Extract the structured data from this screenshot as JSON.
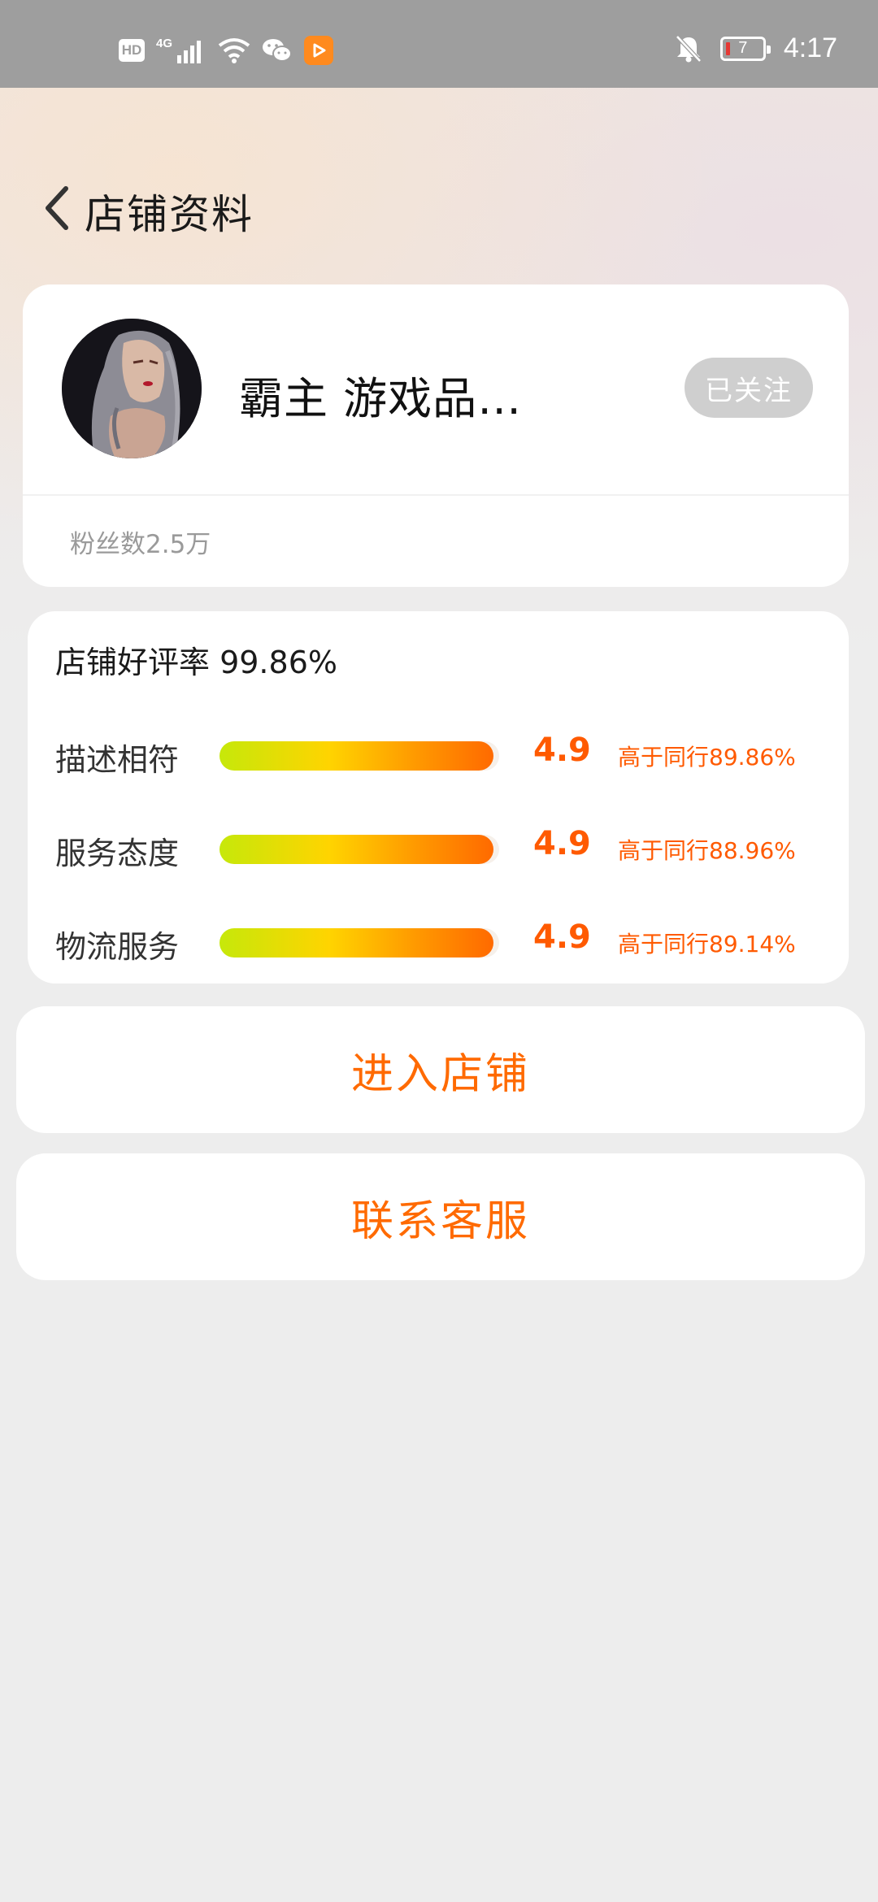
{
  "status_bar": {
    "hd_label": "HD",
    "network_label": "4G",
    "battery_level": "7",
    "time": "4:17",
    "icons": [
      "hd-icon",
      "signal-icon",
      "wifi-icon",
      "wechat-icon",
      "video-app-icon",
      "mute-bell-icon",
      "battery-icon"
    ]
  },
  "header": {
    "back_icon": "chevron-left-icon",
    "title": "店铺资料"
  },
  "shop": {
    "name": "霸主 游戏品…",
    "follow_label": "已关注",
    "fans_label": "粉丝数2.5万"
  },
  "ratings": {
    "good_rate_label": "店铺好评率 99.86%",
    "rows": [
      {
        "label": "描述相符",
        "score": "4.9",
        "compare": "高于同行89.86%",
        "fill_fraction": 0.98
      },
      {
        "label": "服务态度",
        "score": "4.9",
        "compare": "高于同行88.96%",
        "fill_fraction": 0.98
      },
      {
        "label": "物流服务",
        "score": "4.9",
        "compare": "高于同行89.14%",
        "fill_fraction": 0.98
      }
    ]
  },
  "actions": {
    "enter_shop_label": "进入店铺",
    "contact_service_label": "联系客服"
  },
  "colors": {
    "accent": "#ff6a00",
    "status_bar_bg": "#9e9e9e",
    "page_bg": "#ededed",
    "follow_btn_bg": "#cfcfcf"
  }
}
